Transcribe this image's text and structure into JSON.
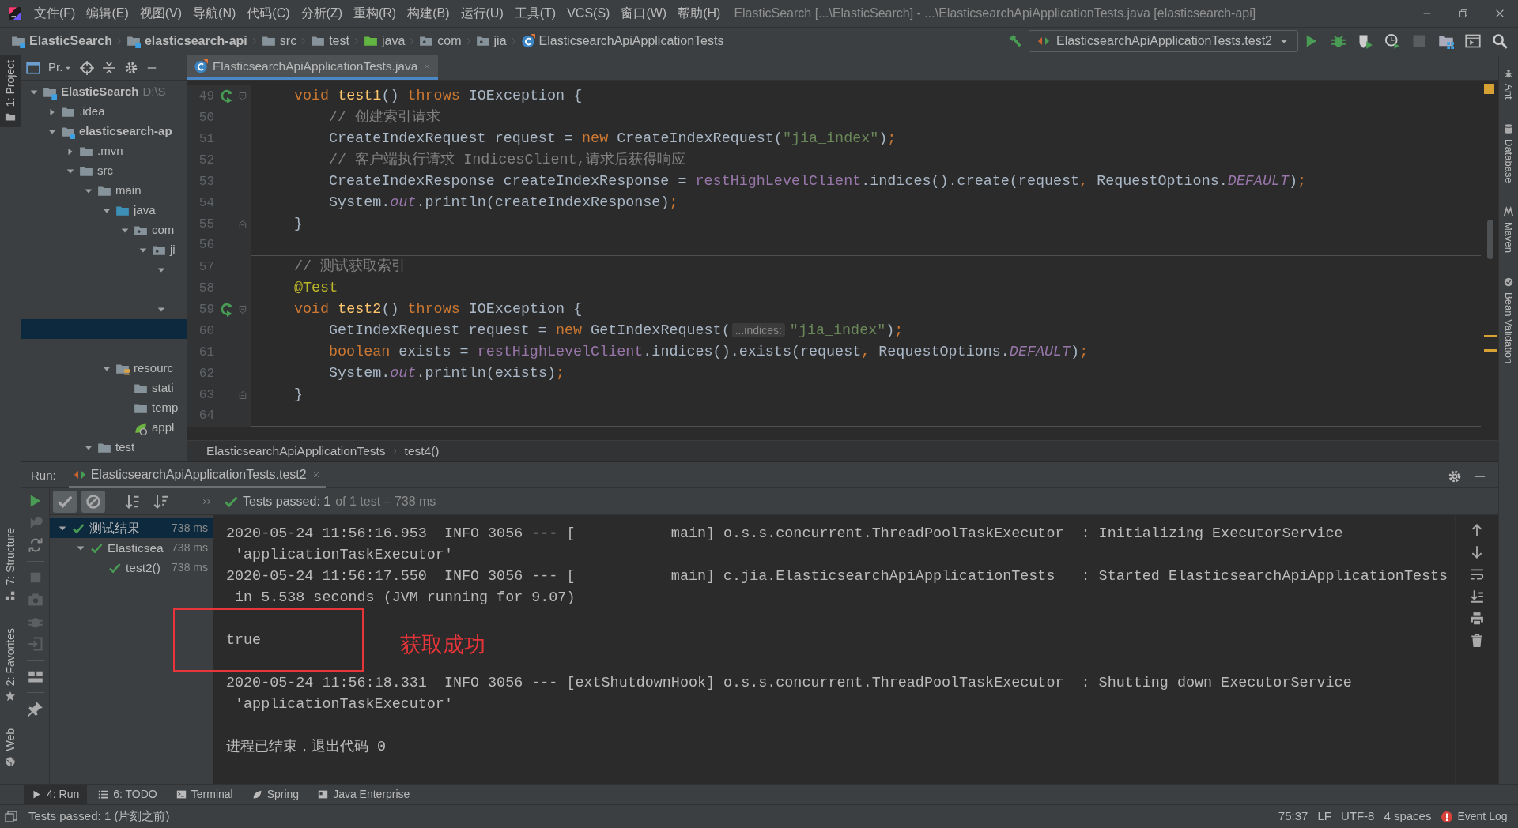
{
  "window": {
    "title": "ElasticSearch [...\\ElasticSearch] - ...\\ElasticsearchApiApplicationTests.java [elasticsearch-api]"
  },
  "menu": [
    "文件(F)",
    "编辑(E)",
    "视图(V)",
    "导航(N)",
    "代码(C)",
    "分析(Z)",
    "重构(R)",
    "构建(B)",
    "运行(U)",
    "工具(T)",
    "VCS(S)",
    "窗口(W)",
    "帮助(H)"
  ],
  "breadcrumbs": [
    {
      "label": "ElasticSearch",
      "kind": "module",
      "bold": true
    },
    {
      "label": "elasticsearch-api",
      "kind": "module",
      "bold": true
    },
    {
      "label": "src",
      "kind": "folder",
      "bold": false
    },
    {
      "label": "test",
      "kind": "folder",
      "bold": false
    },
    {
      "label": "java",
      "kind": "test_source",
      "bold": false
    },
    {
      "label": "com",
      "kind": "package",
      "bold": false
    },
    {
      "label": "jia",
      "kind": "package",
      "bold": false
    },
    {
      "label": "ElasticsearchApiApplicationTests",
      "kind": "class",
      "bold": false
    }
  ],
  "run_config": {
    "label": "ElasticsearchApiApplicationTests.test2"
  },
  "left_strip": [
    {
      "label": "1: Project",
      "kind": "project",
      "selected": true
    }
  ],
  "left_strip_lower": [
    {
      "label": "7: Structure",
      "kind": "structure"
    },
    {
      "label": "2: Favorites",
      "kind": "favorites"
    },
    {
      "label": "Web",
      "kind": "web"
    }
  ],
  "right_strip": [
    {
      "label": "Ant",
      "kind": "ant"
    },
    {
      "label": "Database",
      "kind": "database"
    },
    {
      "label": "Maven",
      "kind": "maven"
    },
    {
      "label": "Bean Validation",
      "kind": "bean"
    }
  ],
  "project_panel": {
    "title": "Pr.",
    "tree": [
      {
        "label": "ElasticSearch",
        "detail": "D:\\S",
        "kind": "module",
        "bold": true,
        "expanded": true,
        "selected": false,
        "children": [
          {
            "label": ".idea",
            "kind": "folder",
            "bold": false,
            "expanded": false,
            "selected": false
          },
          {
            "label": "elasticsearch-ap",
            "kind": "module",
            "bold": true,
            "expanded": true,
            "selected": false,
            "children": [
              {
                "label": ".mvn",
                "kind": "folder",
                "bold": false,
                "expanded": false,
                "selected": false
              },
              {
                "label": "src",
                "kind": "folder",
                "bold": false,
                "expanded": true,
                "selected": false,
                "children": [
                  {
                    "label": "main",
                    "kind": "folder",
                    "bold": false,
                    "expanded": true,
                    "selected": false,
                    "children": [
                      {
                        "label": "java",
                        "kind": "source",
                        "bold": false,
                        "expanded": true,
                        "selected": false,
                        "children": [
                          {
                            "label": "com",
                            "kind": "package",
                            "bold": false,
                            "expanded": true,
                            "selected": false,
                            "children": [
                              {
                                "label": "ji",
                                "kind": "package",
                                "bold": false,
                                "expanded": true,
                                "selected": false,
                                "children": [
                                  {
                                    "expanded": true,
                                    "selected": false,
                                    "children": [
                                      {
                                        "selected": false
                                      }
                                    ]
                                  },
                                  {
                                    "expanded": true,
                                    "selected": false,
                                    "children": [
                                      {
                                        "selected": true
                                      },
                                      {
                                        "selected": false
                                      }
                                    ]
                                  }
                                ]
                              }
                            ]
                          }
                        ]
                      },
                      {
                        "label": "resourc",
                        "kind": "resources",
                        "bold": false,
                        "expanded": true,
                        "selected": false,
                        "children": [
                          {
                            "label": "stati",
                            "kind": "folder",
                            "bold": false,
                            "selected": false
                          },
                          {
                            "label": "temp",
                            "kind": "folder",
                            "bold": false,
                            "selected": false
                          },
                          {
                            "label": "appl",
                            "kind": "spring",
                            "bold": false,
                            "selected": false
                          }
                        ]
                      }
                    ]
                  },
                  {
                    "label": "test",
                    "kind": "folder",
                    "bold": false,
                    "expanded": true,
                    "selected": false
                  }
                ]
              }
            ]
          }
        ]
      }
    ]
  },
  "editor": {
    "tab": {
      "label": "ElasticsearchApiApplicationTests.java",
      "selected": true
    },
    "lines": [
      {
        "number": "49",
        "kind": "member",
        "run_marker": true,
        "fold_start": true,
        "fold_end": false,
        "tokens": [
          {
            "kind": "kw",
            "t": "void "
          },
          {
            "kind": "method",
            "t": "test1"
          },
          {
            "kind": "plain",
            "t": "() "
          },
          {
            "kind": "kw",
            "t": "throws "
          },
          {
            "kind": "plain",
            "t": "IOException {"
          }
        ]
      },
      {
        "number": "50",
        "kind": "body",
        "run_marker": false,
        "fold_start": false,
        "fold_end": false,
        "tokens": [
          {
            "kind": "comment",
            "t": "// 创建索引请求"
          }
        ]
      },
      {
        "number": "51",
        "kind": "body",
        "run_marker": false,
        "fold_start": false,
        "fold_end": false,
        "tokens": [
          {
            "kind": "plain",
            "t": "CreateIndexRequest request = "
          },
          {
            "kind": "kw",
            "t": "new "
          },
          {
            "kind": "plain",
            "t": "CreateIndexRequest("
          },
          {
            "kind": "str",
            "t": "\"jia_index\""
          },
          {
            "kind": "plain",
            "t": ")"
          },
          {
            "kind": "kw",
            "t": ";"
          }
        ]
      },
      {
        "number": "52",
        "kind": "body",
        "run_marker": false,
        "fold_start": false,
        "fold_end": false,
        "tokens": [
          {
            "kind": "comment",
            "t": "// 客户端执行请求 IndicesClient,请求后获得响应"
          }
        ]
      },
      {
        "number": "53",
        "kind": "body",
        "run_marker": false,
        "fold_start": false,
        "fold_end": false,
        "tokens": [
          {
            "kind": "plain",
            "t": "CreateIndexResponse createIndexResponse = "
          },
          {
            "kind": "field",
            "t": "restHighLevelClient"
          },
          {
            "kind": "plain",
            "t": ".indices().create(request"
          },
          {
            "kind": "kw",
            "t": ", "
          },
          {
            "kind": "plain",
            "t": "RequestOptions."
          },
          {
            "kind": "static",
            "t": "DEFAULT"
          },
          {
            "kind": "plain",
            "t": ")"
          },
          {
            "kind": "kw",
            "t": ";"
          }
        ]
      },
      {
        "number": "54",
        "kind": "body",
        "run_marker": false,
        "fold_start": false,
        "fold_end": false,
        "tokens": [
          {
            "kind": "plain",
            "t": "System."
          },
          {
            "kind": "static",
            "t": "out"
          },
          {
            "kind": "plain",
            "t": ".println(createIndexResponse)"
          },
          {
            "kind": "kw",
            "t": ";"
          }
        ]
      },
      {
        "number": "55",
        "kind": "member",
        "run_marker": false,
        "fold_start": false,
        "fold_end": true,
        "tokens": [
          {
            "kind": "plain",
            "t": "}"
          }
        ]
      },
      {
        "number": "56",
        "run_marker": false,
        "fold_start": false,
        "fold_end": false,
        "separator_below": true
      },
      {
        "number": "57",
        "kind": "member",
        "run_marker": false,
        "fold_start": false,
        "fold_end": false,
        "tokens": [
          {
            "kind": "comment",
            "t": "// 测试获取索引"
          }
        ]
      },
      {
        "number": "58",
        "kind": "member",
        "run_marker": false,
        "fold_start": false,
        "fold_end": false,
        "tokens": [
          {
            "kind": "annotation",
            "t": "@Test"
          }
        ]
      },
      {
        "number": "59",
        "kind": "member",
        "run_marker": true,
        "fold_start": true,
        "fold_end": false,
        "tokens": [
          {
            "kind": "kw",
            "t": "void "
          },
          {
            "kind": "method",
            "t": "test2"
          },
          {
            "kind": "plain",
            "t": "() "
          },
          {
            "kind": "kw",
            "t": "throws "
          },
          {
            "kind": "plain",
            "t": "IOException {"
          }
        ]
      },
      {
        "number": "60",
        "kind": "body",
        "run_marker": false,
        "fold_start": false,
        "fold_end": false,
        "tokens": [
          {
            "kind": "plain",
            "t": "GetIndexRequest request = "
          },
          {
            "kind": "kw",
            "t": "new "
          },
          {
            "kind": "plain",
            "t": "GetIndexRequest("
          },
          {
            "kind": "hint",
            "t": "...indices:"
          },
          {
            "kind": "str",
            "t": "\"jia_index\""
          },
          {
            "kind": "plain",
            "t": ")"
          },
          {
            "kind": "kw",
            "t": ";"
          }
        ]
      },
      {
        "number": "61",
        "kind": "body",
        "run_marker": false,
        "fold_start": false,
        "fold_end": false,
        "tokens": [
          {
            "kind": "kw",
            "t": "boolean "
          },
          {
            "kind": "plain",
            "t": "exists = "
          },
          {
            "kind": "field",
            "t": "restHighLevelClient"
          },
          {
            "kind": "plain",
            "t": ".indices().exists(request"
          },
          {
            "kind": "kw",
            "t": ", "
          },
          {
            "kind": "plain",
            "t": "RequestOptions."
          },
          {
            "kind": "static",
            "t": "DEFAULT"
          },
          {
            "kind": "plain",
            "t": ")"
          },
          {
            "kind": "kw",
            "t": ";"
          }
        ]
      },
      {
        "number": "62",
        "kind": "body",
        "run_marker": false,
        "fold_start": false,
        "fold_end": false,
        "tokens": [
          {
            "kind": "plain",
            "t": "System."
          },
          {
            "kind": "static",
            "t": "out"
          },
          {
            "kind": "plain",
            "t": ".println(exists)"
          },
          {
            "kind": "kw",
            "t": ";"
          }
        ]
      },
      {
        "number": "63",
        "kind": "member",
        "run_marker": false,
        "fold_start": false,
        "fold_end": true,
        "tokens": [
          {
            "kind": "plain",
            "t": "}"
          }
        ]
      },
      {
        "number": "64",
        "run_marker": false,
        "fold_start": false,
        "fold_end": false,
        "separator_below": true
      }
    ],
    "breadcrumb": [
      "ElasticsearchApiApplicationTests",
      "test4()"
    ]
  },
  "run": {
    "label": "Run:",
    "tab": {
      "label": "ElasticsearchApiApplicationTests.test2",
      "selected": true
    },
    "summary": "Tests passed: 1",
    "summary_detail": "of 1 test – 738 ms",
    "tests": [
      {
        "label": "测试结果",
        "time": "738 ms",
        "selected": true,
        "children": [
          {
            "label": "Elasticsea",
            "time": "738 ms",
            "selected": false,
            "children": [
              {
                "label": "test2()",
                "time": "738 ms",
                "selected": false
              }
            ]
          }
        ]
      }
    ],
    "console": [
      [
        "2020-05-24 11:56:16.953  INFO 3056 --- [           main] o.s.s.concurrent.ThreadPoolTaskExecutor  : Initializing ExecutorService",
        " 'applicationTaskExecutor'",
        "2020-05-24 11:56:17.550  INFO 3056 --- [           main] c.jia.ElasticsearchApiApplicationTests   : Started ElasticsearchApiApplicationTests",
        " in 5.538 seconds (JVM running for 9.07)"
      ],
      [
        "true"
      ],
      [
        "2020-05-24 11:56:18.331  INFO 3056 --- [extShutdownHook] o.s.s.concurrent.ThreadPoolTaskExecutor  : Shutting down ExecutorService",
        " 'applicationTaskExecutor'"
      ],
      [
        "进程已结束，退出代码 0"
      ]
    ],
    "annotation": {
      "text": "获取成功"
    }
  },
  "tool_tabs": [
    {
      "label": "4: Run",
      "kind": "run",
      "selected": true
    },
    {
      "label": "6: TODO",
      "kind": "todo",
      "selected": false
    },
    {
      "label": "Terminal",
      "kind": "terminal",
      "selected": false
    },
    {
      "label": "Spring",
      "kind": "spring",
      "selected": false
    },
    {
      "label": "Java Enterprise",
      "kind": "javaee",
      "selected": false
    }
  ],
  "status": {
    "text": "Tests passed: 1 (片刻之前)",
    "event_log": "Event Log",
    "items": [
      "75:37",
      "LF",
      "UTF-8",
      "4 spaces"
    ]
  }
}
